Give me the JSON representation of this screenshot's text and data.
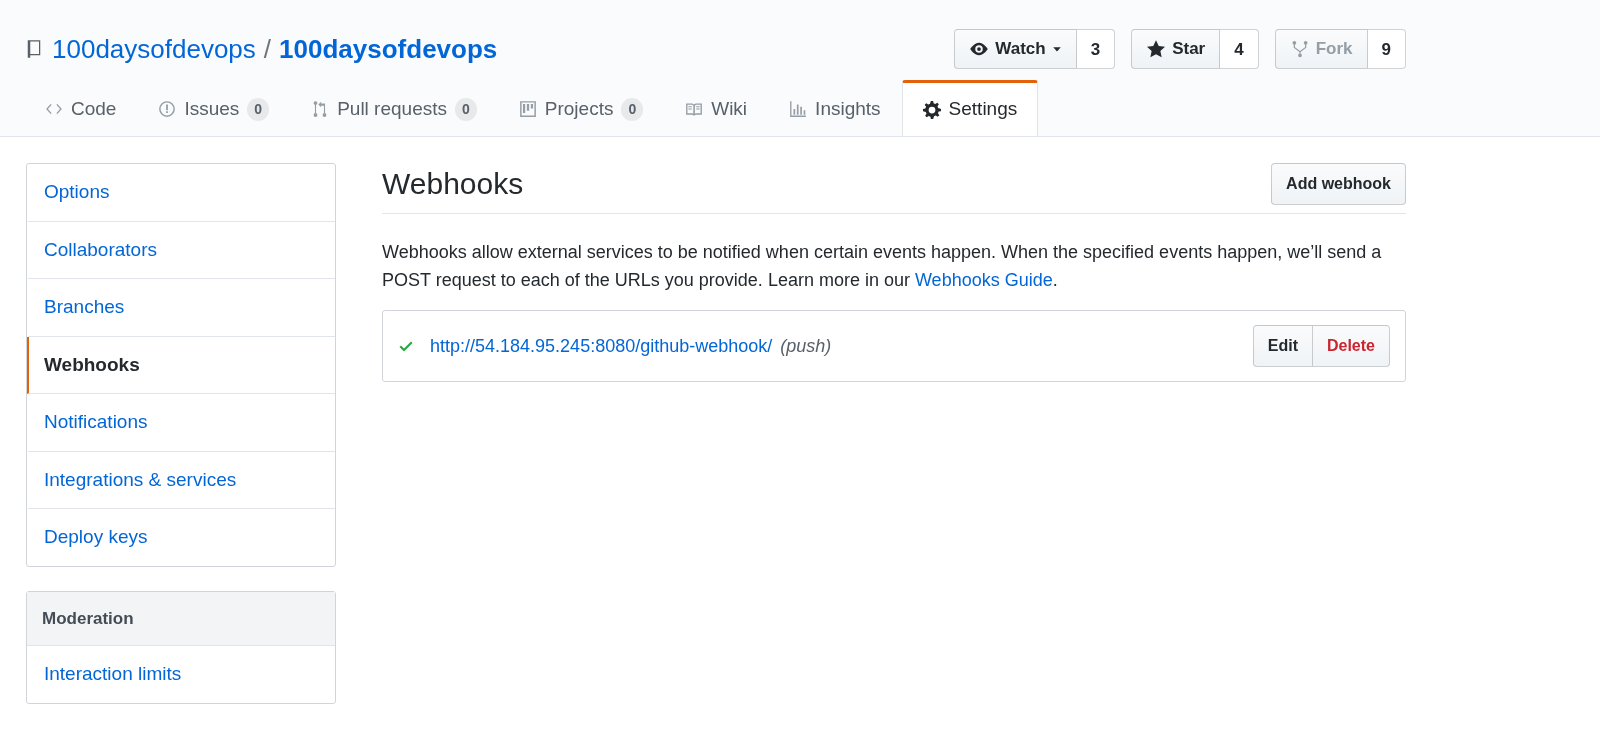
{
  "repo": {
    "owner": "100daysofdevops",
    "separator": "/",
    "name": "100daysofdevops"
  },
  "actions": [
    {
      "kind": "watch",
      "label": "Watch",
      "count": "3",
      "disabled": false
    },
    {
      "kind": "star",
      "label": "Star",
      "count": "4",
      "disabled": false
    },
    {
      "kind": "fork",
      "label": "Fork",
      "count": "9",
      "disabled": true
    }
  ],
  "tabs": [
    {
      "kind": "code",
      "label": "Code",
      "selected": false
    },
    {
      "kind": "issues",
      "label": "Issues",
      "count": "0",
      "selected": false
    },
    {
      "kind": "pulls",
      "label": "Pull requests",
      "count": "0",
      "selected": false
    },
    {
      "kind": "projects",
      "label": "Projects",
      "count": "0",
      "selected": false
    },
    {
      "kind": "wiki",
      "label": "Wiki",
      "selected": false
    },
    {
      "kind": "insights",
      "label": "Insights",
      "selected": false
    },
    {
      "kind": "settings",
      "label": "Settings",
      "selected": true
    }
  ],
  "sidebar": {
    "items": [
      {
        "label": "Options",
        "selected": false
      },
      {
        "label": "Collaborators",
        "selected": false
      },
      {
        "label": "Branches",
        "selected": false
      },
      {
        "label": "Webhooks",
        "selected": true
      },
      {
        "label": "Notifications",
        "selected": false
      },
      {
        "label": "Integrations & services",
        "selected": false
      },
      {
        "label": "Deploy keys",
        "selected": false
      }
    ]
  },
  "moderation": {
    "heading": "Moderation",
    "items": [
      {
        "label": "Interaction limits",
        "selected": false
      }
    ]
  },
  "page": {
    "title": "Webhooks",
    "add_button": "Add webhook",
    "description": {
      "text": "Webhooks allow external services to be notified when certain events happen. When the specified events happen, we’ll send a POST request to each of the URLs you provide. Learn more in our ",
      "link": "Webhooks Guide",
      "after": "."
    },
    "hooks": [
      {
        "active": true,
        "url": "http://54.184.95.245:8080/github-webhook/",
        "events": "(push)",
        "edit": "Edit",
        "delete": "Delete"
      }
    ]
  }
}
